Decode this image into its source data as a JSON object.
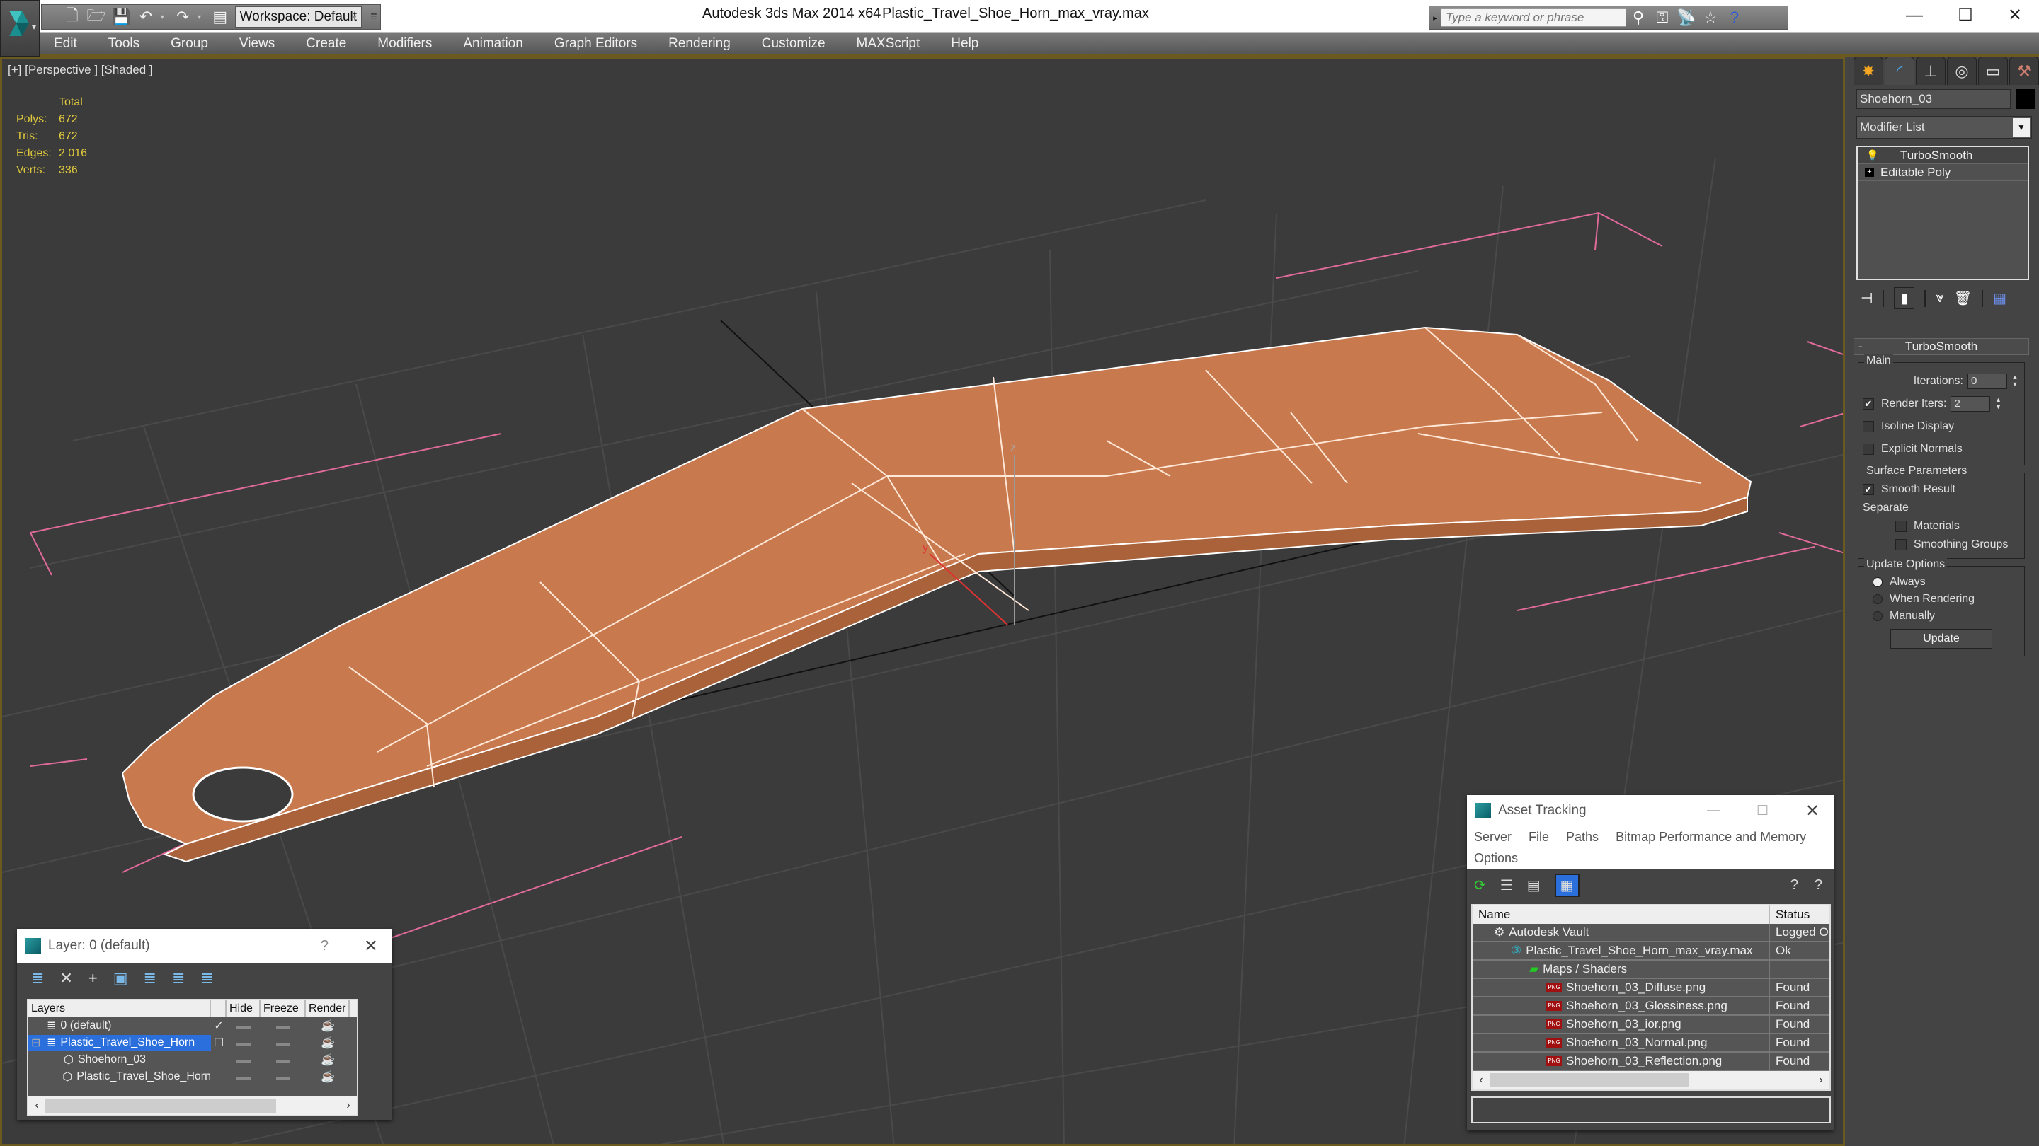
{
  "titlebar": {
    "app_title": "Autodesk 3ds Max  2014 x64",
    "file_name": "Plastic_Travel_Shoe_Horn_max_vray.max",
    "workspace": "Workspace: Default",
    "search_placeholder": "Type a keyword or phrase",
    "quick_access_icons": [
      "new-file-icon",
      "open-file-icon",
      "save-icon",
      "undo-icon",
      "redo-icon",
      "project-folder-icon"
    ],
    "search_icons": [
      "binoculars-icon",
      "key-icon",
      "satellite-icon",
      "star-icon",
      "help-icon"
    ],
    "window_controls": {
      "minimize": "—",
      "maximize": "☐",
      "close": "✕"
    }
  },
  "menu": [
    "Edit",
    "Tools",
    "Group",
    "Views",
    "Create",
    "Modifiers",
    "Animation",
    "Graph Editors",
    "Rendering",
    "Customize",
    "MAXScript",
    "Help"
  ],
  "viewport": {
    "label": "[+] [Perspective ] [Shaded ]",
    "stats": {
      "header": "Total",
      "rows": [
        {
          "k": "Polys:",
          "v": "672"
        },
        {
          "k": "Tris:",
          "v": "672"
        },
        {
          "k": "Edges:",
          "v": "2 016"
        },
        {
          "k": "Verts:",
          "v": "336"
        }
      ]
    },
    "model_color": "#c87a4e",
    "axis_labels": {
      "z": "z",
      "y": "y"
    }
  },
  "command_panel": {
    "tabs": [
      "create-icon",
      "modify-icon",
      "hierarchy-icon",
      "motion-icon",
      "display-icon",
      "utilities-icon"
    ],
    "object_name": "Shoehorn_03",
    "modifier_list": "Modifier List",
    "stack": [
      "TurboSmooth",
      "Editable Poly"
    ],
    "turbosmooth": {
      "title": "TurboSmooth",
      "main_title": "Main",
      "iterations_label": "Iterations:",
      "iterations_value": "0",
      "render_iters_label": "Render Iters:",
      "render_iters_value": "2",
      "render_iters_checked": true,
      "isoline_display": "Isoline Display",
      "explicit_normals": "Explicit Normals",
      "surface_params_title": "Surface Parameters",
      "smooth_result": "Smooth Result",
      "separate": "Separate",
      "materials": "Materials",
      "smoothing_groups": "Smoothing Groups",
      "update_options_title": "Update Options",
      "always": "Always",
      "when_rendering": "When Rendering",
      "manually": "Manually",
      "update_button": "Update"
    }
  },
  "layer_dialog": {
    "title": "Layer: 0 (default)",
    "help": "?",
    "columns": [
      "Layers",
      "",
      "Hide",
      "Freeze",
      "Render"
    ],
    "rows": [
      {
        "name": "0 (default)",
        "active": "✓"
      },
      {
        "name": "Plastic_Travel_Shoe_Horn",
        "active": "☐"
      },
      {
        "name": "Shoehorn_03",
        "active": ""
      },
      {
        "name": "Plastic_Travel_Shoe_Horn",
        "active": ""
      }
    ]
  },
  "asset_dialog": {
    "title": "Asset Tracking",
    "menu_row1": [
      "Server",
      "File",
      "Paths",
      "Bitmap Performance and Memory"
    ],
    "menu_row2": [
      "Options"
    ],
    "columns": [
      "Name",
      "Status"
    ],
    "rows": [
      {
        "name": "Autodesk Vault",
        "status": "Logged O"
      },
      {
        "name": "Plastic_Travel_Shoe_Horn_max_vray.max",
        "status": "Ok"
      },
      {
        "name": "Maps / Shaders",
        "status": ""
      },
      {
        "name": "Shoehorn_03_Diffuse.png",
        "status": "Found"
      },
      {
        "name": "Shoehorn_03_Glossiness.png",
        "status": "Found"
      },
      {
        "name": "Shoehorn_03_ior.png",
        "status": "Found"
      },
      {
        "name": "Shoehorn_03_Normal.png",
        "status": "Found"
      },
      {
        "name": "Shoehorn_03_Reflection.png",
        "status": "Found"
      }
    ]
  }
}
